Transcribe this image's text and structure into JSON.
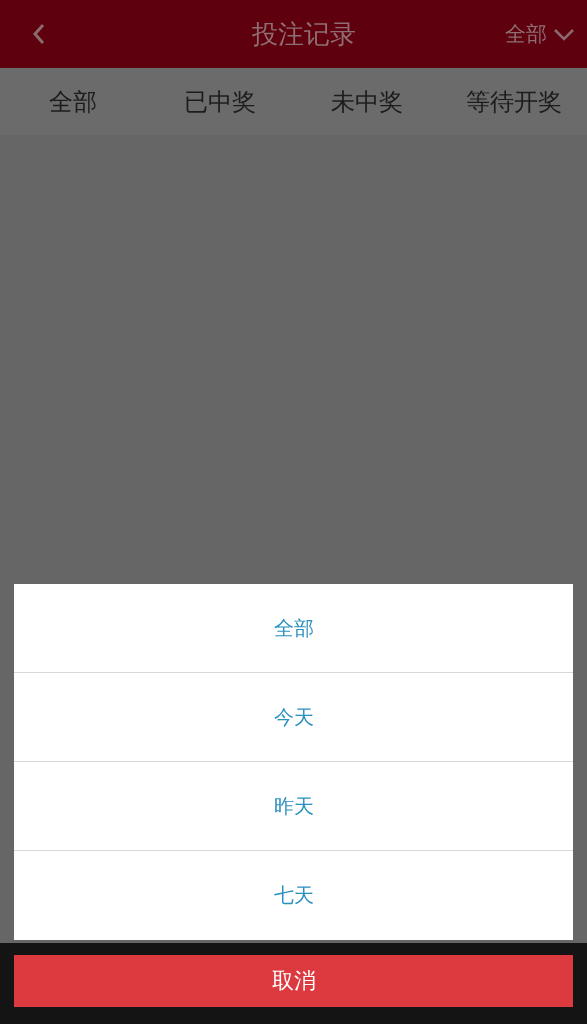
{
  "header": {
    "title": "投注记录",
    "filter": "全部"
  },
  "tabs": [
    {
      "label": "全部",
      "selected": false
    },
    {
      "label": "已中奖",
      "selected": false
    },
    {
      "label": "未中奖",
      "selected": false
    },
    {
      "label": "等待开奖",
      "selected": false
    }
  ],
  "action_sheet": {
    "options": [
      "全部",
      "今天",
      "昨天",
      "七天"
    ],
    "cancel": "取消"
  }
}
